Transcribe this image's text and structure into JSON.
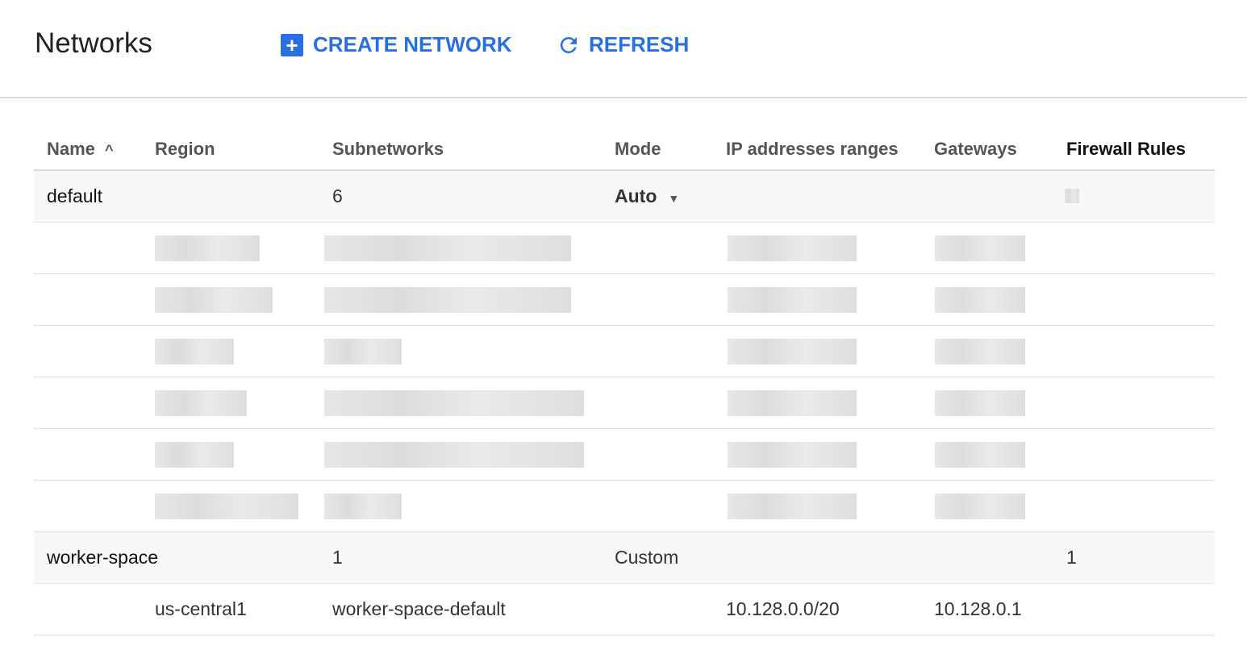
{
  "header": {
    "title": "Networks",
    "create_label": "CREATE NETWORK",
    "refresh_label": "REFRESH",
    "accent": "#2a6ee0"
  },
  "table": {
    "columns": [
      "Name",
      "Region",
      "Subnetworks",
      "Mode",
      "IP addresses ranges",
      "Gateways",
      "Firewall Rules"
    ],
    "sort": {
      "column": "Name",
      "direction": "ascending"
    },
    "networks": [
      {
        "name": "default",
        "subnetworks": "6",
        "mode": "Auto",
        "firewall_rules": ""
      },
      {
        "name": "worker-space",
        "subnetworks": "1",
        "mode": "Custom",
        "firewall_rules": "1",
        "subnets": [
          {
            "region": "us-central1",
            "name": "worker-space-default",
            "ip_range": "10.128.0.0/20",
            "gateway": "10.128.0.1"
          }
        ]
      }
    ]
  }
}
